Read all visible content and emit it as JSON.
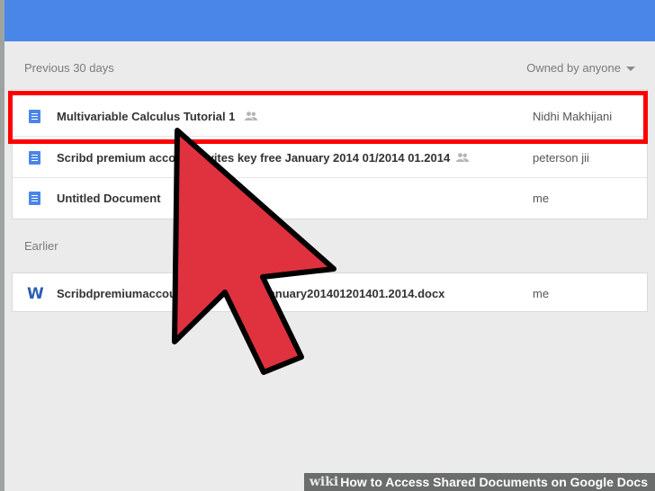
{
  "colors": {
    "topbar": "#4a86e8",
    "doc_icon": "#4a86e8",
    "word_icon": "#2b5fb4",
    "highlight": "#ff0000",
    "cursor_fill": "#e0313f"
  },
  "sections": {
    "recent": "Previous 30 days",
    "earlier": "Earlier"
  },
  "owner_filter": {
    "label": "Owned by anyone"
  },
  "recent_files": [
    {
      "name": "Multivariable Calculus Tutorial 1",
      "shared": true,
      "owner": "Nidhi Makhijani",
      "icon": "google-doc-icon"
    },
    {
      "name": "Scribd premium account invites key free January 2014 01/2014 01.2014",
      "shared": true,
      "owner": "peterson jii",
      "icon": "google-doc-icon"
    },
    {
      "name": "Untitled Document",
      "shared": false,
      "owner": "me",
      "icon": "google-doc-icon"
    }
  ],
  "earlier_files": [
    {
      "name": "Scribdpremiumaccountinviteskeyfreejanuary201401201401.2014.docx",
      "shared": false,
      "owner": "me",
      "icon": "word-doc-icon",
      "icon_glyph": "W"
    }
  ],
  "banner": {
    "brand": "wiki",
    "title": "How to Access Shared Documents on Google Docs"
  }
}
